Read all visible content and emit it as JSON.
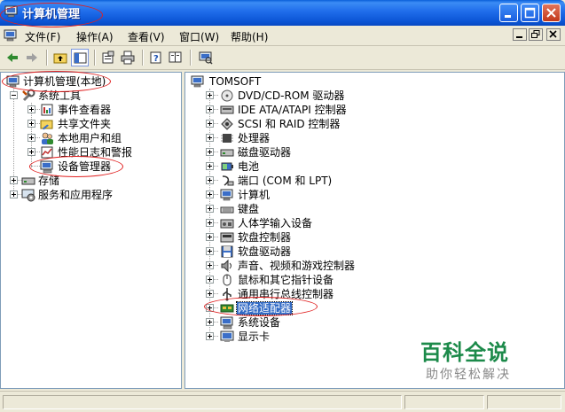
{
  "window": {
    "title": "计算机管理"
  },
  "menu": [
    {
      "label": "文件(F)"
    },
    {
      "label": "操作(A)"
    },
    {
      "label": "查看(V)"
    },
    {
      "label": "窗口(W)"
    },
    {
      "label": "帮助(H)"
    }
  ],
  "toolbar": [
    {
      "icon": "back-arrow-icon"
    },
    {
      "icon": "forward-arrow-icon"
    },
    {
      "icon": "up-folder-icon"
    },
    {
      "icon": "show-hide-tree-icon"
    },
    {
      "icon": "properties-icon"
    },
    {
      "icon": "print-icon"
    },
    {
      "icon": "help-icon"
    },
    {
      "icon": "export-list-icon"
    },
    {
      "icon": "scan-hardware-icon"
    }
  ],
  "left_tree": {
    "root": "计算机管理(本地)",
    "system_tools": "系统工具",
    "children": [
      "事件查看器",
      "共享文件夹",
      "本地用户和组",
      "性能日志和警报",
      "设备管理器"
    ],
    "storage": "存储",
    "services": "服务和应用程序"
  },
  "right_tree": {
    "root": "TOMSOFT",
    "items": [
      {
        "label": "DVD/CD-ROM 驱动器",
        "icon": "cdrom-icon"
      },
      {
        "label": "IDE ATA/ATAPI 控制器",
        "icon": "ide-controller-icon"
      },
      {
        "label": "SCSI 和 RAID 控制器",
        "icon": "scsi-icon"
      },
      {
        "label": "处理器",
        "icon": "processor-icon"
      },
      {
        "label": "磁盘驱动器",
        "icon": "disk-drive-icon"
      },
      {
        "label": "电池",
        "icon": "battery-icon"
      },
      {
        "label": "端口 (COM 和 LPT)",
        "icon": "port-icon"
      },
      {
        "label": "计算机",
        "icon": "computer-icon"
      },
      {
        "label": "键盘",
        "icon": "keyboard-icon"
      },
      {
        "label": "人体学输入设备",
        "icon": "hid-icon"
      },
      {
        "label": "软盘控制器",
        "icon": "floppy-controller-icon"
      },
      {
        "label": "软盘驱动器",
        "icon": "floppy-drive-icon"
      },
      {
        "label": "声音、视频和游戏控制器",
        "icon": "sound-icon"
      },
      {
        "label": "鼠标和其它指针设备",
        "icon": "mouse-icon"
      },
      {
        "label": "通用串行总线控制器",
        "icon": "usb-icon"
      },
      {
        "label": "网络适配器",
        "icon": "network-adapter-icon"
      },
      {
        "label": "系统设备",
        "icon": "system-device-icon"
      },
      {
        "label": "显示卡",
        "icon": "display-adapter-icon"
      }
    ]
  },
  "watermark": {
    "main": "百科全说",
    "sub": "助你轻松解决"
  },
  "colors": {
    "titlebar": "#0a54d4",
    "selection": "#316ac5",
    "annotation": "#e02020",
    "watermark": "#1c8a4a"
  }
}
